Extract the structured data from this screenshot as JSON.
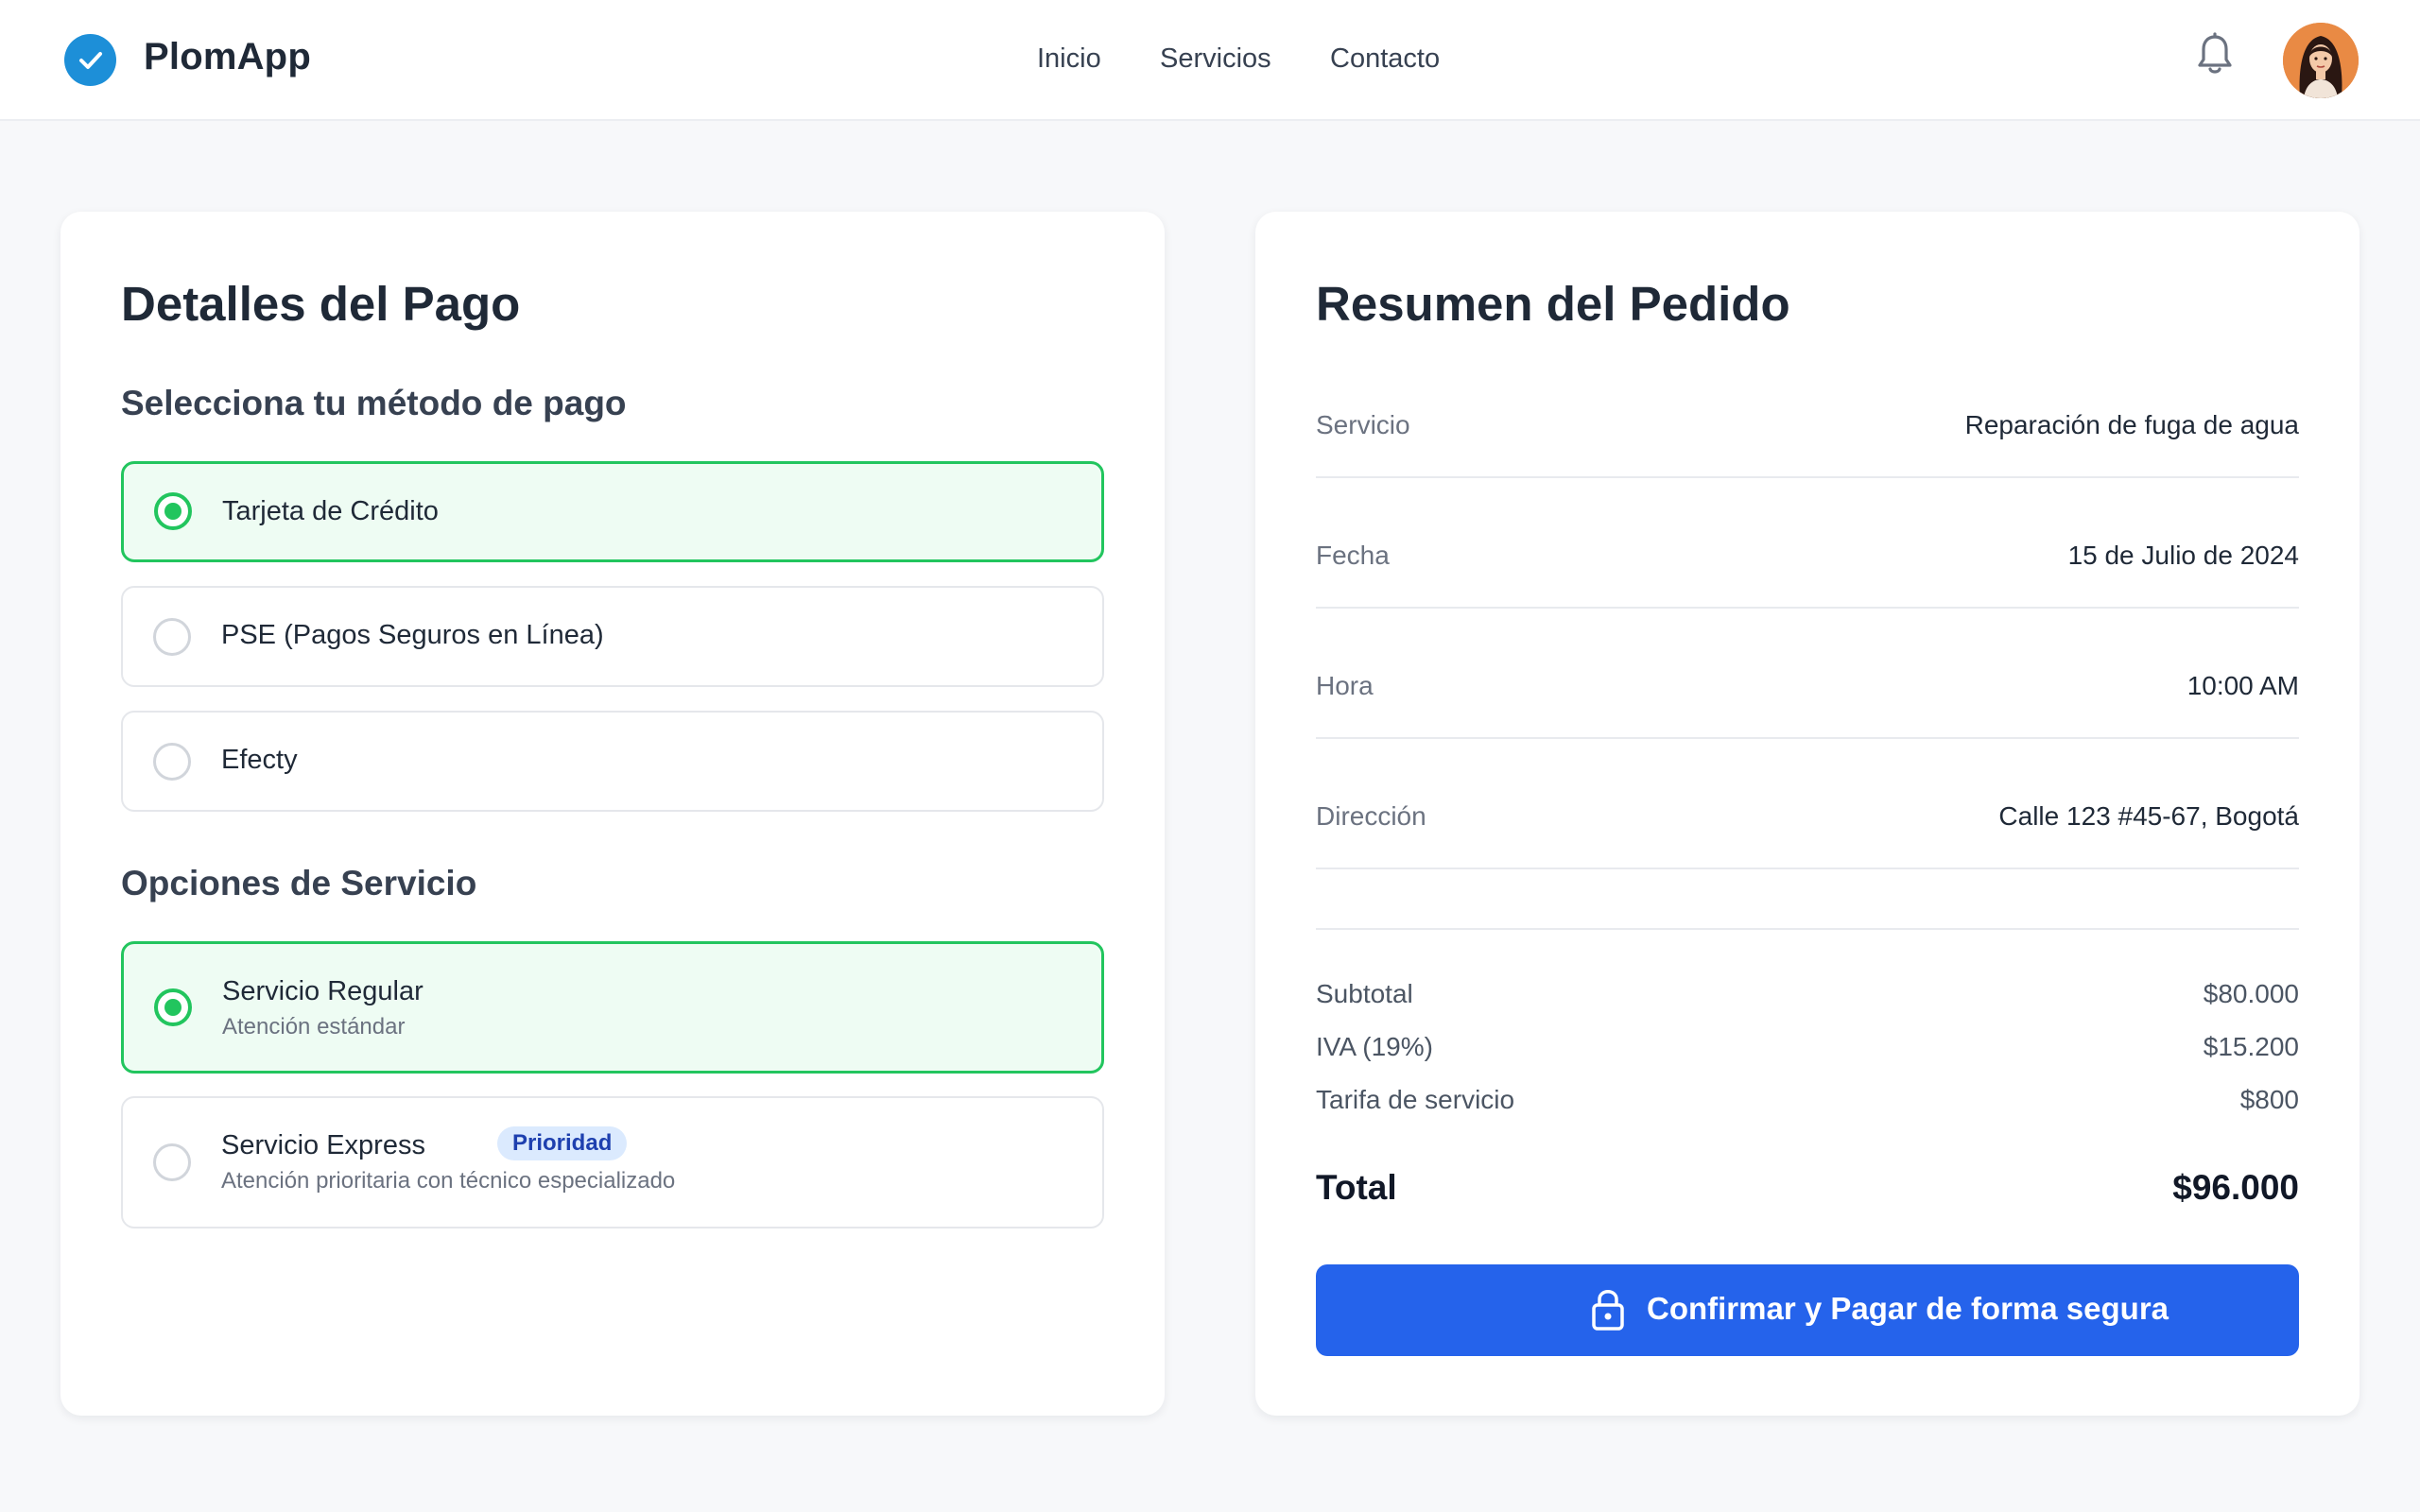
{
  "header": {
    "brand": "PlomApp",
    "nav": [
      "Inicio",
      "Servicios",
      "Contacto"
    ],
    "bell_icon": "bell-icon",
    "avatar_icon": "user-avatar"
  },
  "payment": {
    "title": "Detalles del Pago",
    "method_heading": "Selecciona tu método de pago",
    "methods": [
      {
        "label": "Tarjeta de Crédito",
        "selected": true
      },
      {
        "label": "PSE (Pagos Seguros en Línea)",
        "selected": false
      },
      {
        "label": "Efecty",
        "selected": false
      }
    ],
    "service_heading": "Opciones de Servicio",
    "services": [
      {
        "label": "Servicio Regular",
        "description": "Atención estándar",
        "selected": true
      },
      {
        "label": "Servicio Express",
        "badge": "Prioridad",
        "description": "Atención prioritaria con técnico especializado",
        "selected": false
      }
    ]
  },
  "summary": {
    "title": "Resumen del Pedido",
    "rows": [
      {
        "label": "Servicio",
        "value": "Reparación de fuga de agua"
      },
      {
        "label": "Fecha",
        "value": "15 de Julio de 2024"
      },
      {
        "label": "Hora",
        "value": "10:00 AM"
      },
      {
        "label": "Dirección",
        "value": "Calle 123 #45-67, Bogotá"
      }
    ],
    "costs": [
      {
        "label": "Subtotal",
        "value": "$80.000"
      },
      {
        "label": "IVA (19%)",
        "value": "$15.200"
      },
      {
        "label": "Tarifa de servicio",
        "value": "$800"
      }
    ],
    "total_label": "Total",
    "total_value": "$96.000",
    "pay_button": "Confirmar y Pagar de forma segura"
  },
  "colors": {
    "accent": "#2563eb",
    "selected": "#22c55e",
    "selected_bg": "#eefcf3",
    "brand": "#1d8fd8",
    "badge_bg": "#dbeafe"
  }
}
